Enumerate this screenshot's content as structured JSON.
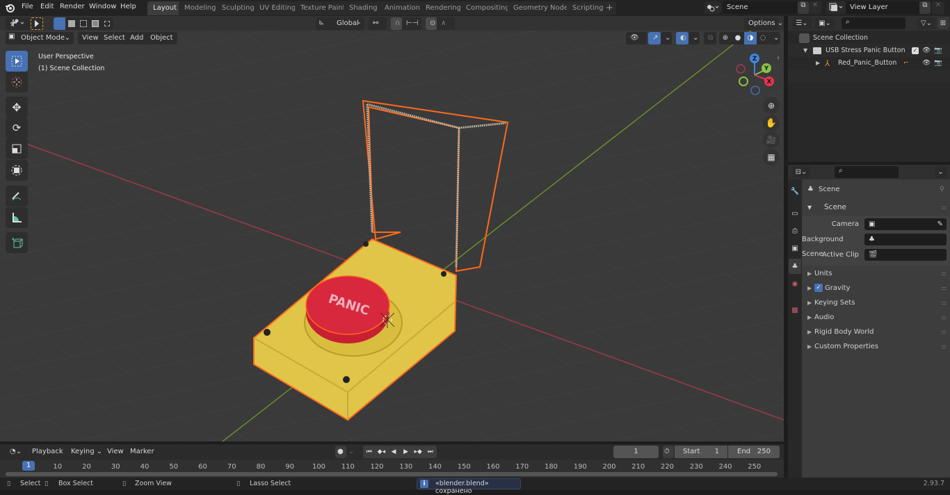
{
  "topbar": {
    "menus": [
      "File",
      "Edit",
      "Render",
      "Window",
      "Help"
    ],
    "workspaces": [
      "Layout",
      "Modeling",
      "Sculpting",
      "UV Editing",
      "Texture Paint",
      "Shading",
      "Animation",
      "Rendering",
      "Compositing",
      "Geometry Nodes",
      "Scripting"
    ],
    "active_workspace": "Layout",
    "add_workspace": "+",
    "scene_name": "Scene",
    "view_layer_name": "View Layer"
  },
  "viewport": {
    "mode": "Object Mode",
    "menus": [
      "View",
      "Select",
      "Add",
      "Object"
    ],
    "orientation": "Global",
    "options_label": "Options",
    "overlay_line1": "User Perspective",
    "overlay_line2": "(1) Scene Collection",
    "gizmo": {
      "x": "X",
      "y": "Y",
      "z": "Z"
    },
    "object_label": "PANIC",
    "colors": {
      "accent": "#4772b3",
      "selection": "#ff6a1a",
      "x_axis": "#e8344f",
      "y_axis": "#8bc34a",
      "z_axis": "#3d86e0",
      "base_yellow": "#e8c94a",
      "button_red": "#d8283e"
    }
  },
  "outliner": {
    "search_placeholder": "",
    "root": "Scene Collection",
    "items": [
      {
        "name": "USB Stress Panic Button",
        "type": "collection",
        "checked": true
      },
      {
        "name": "Red_Panic_Button",
        "type": "armature"
      }
    ]
  },
  "properties": {
    "search_placeholder": "",
    "context": "Scene",
    "panel_title": "Scene",
    "fields": [
      {
        "label": "Camera",
        "value": ""
      },
      {
        "label": "Background Scene",
        "value": ""
      },
      {
        "label": "Active Clip",
        "value": ""
      }
    ],
    "sections": [
      {
        "label": "Units"
      },
      {
        "label": "Gravity",
        "checkbox": true
      },
      {
        "label": "Keying Sets"
      },
      {
        "label": "Audio"
      },
      {
        "label": "Rigid Body World"
      },
      {
        "label": "Custom Properties"
      }
    ]
  },
  "timeline": {
    "menus": [
      "Playback",
      "Keying",
      "View",
      "Marker"
    ],
    "current_frame": "1",
    "start_label": "Start",
    "start_value": "1",
    "end_label": "End",
    "end_value": "250",
    "ticks": [
      "10",
      "20",
      "30",
      "40",
      "50",
      "60",
      "70",
      "80",
      "90",
      "100",
      "110",
      "120",
      "130",
      "140",
      "150",
      "160",
      "170",
      "180",
      "190",
      "200",
      "210",
      "220",
      "230",
      "240",
      "250"
    ],
    "playhead": "1"
  },
  "statusbar": {
    "hints": [
      {
        "icon": "mouse-left-icon",
        "label": "Select"
      },
      {
        "icon": "mouse-drag-icon",
        "label": "Box Select"
      },
      {
        "icon": "mouse-middle-icon",
        "label": "Zoom View"
      },
      {
        "icon": "mouse-right-icon",
        "label": "Lasso Select"
      }
    ],
    "message": "«blender.blend» сохранено",
    "version": "2.93.7"
  }
}
